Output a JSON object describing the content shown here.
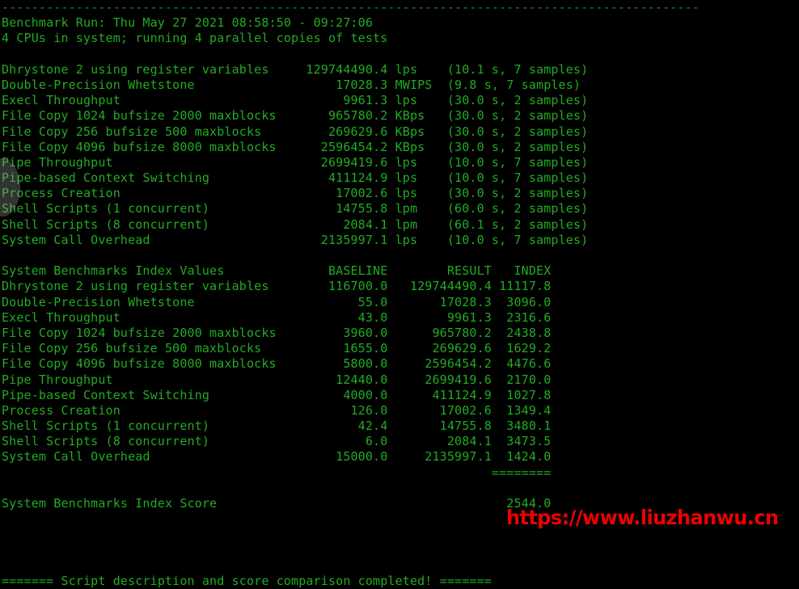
{
  "terminal": {
    "foreground_color": "#23ab23",
    "background_color": "#000000",
    "watermark_color": "#ee0000",
    "top_rule": "----------------------------------------------------------------------------------------------",
    "header": {
      "run_line": "Benchmark Run: Thu May 27 2021 08:58:50 - 09:27:06",
      "cpu_line": "4 CPUs in system; running 4 parallel copies of tests"
    },
    "raw_results": {
      "rows": [
        {
          "label": "Dhrystone 2 using register variables",
          "value": "129744490.4",
          "unit": "lps",
          "detail": "(10.1 s, 7 samples)"
        },
        {
          "label": "Double-Precision Whetstone",
          "value": "17028.3",
          "unit": "MWIPS",
          "detail": "(9.8 s, 7 samples)"
        },
        {
          "label": "Execl Throughput",
          "value": "9961.3",
          "unit": "lps",
          "detail": "(30.0 s, 2 samples)"
        },
        {
          "label": "File Copy 1024 bufsize 2000 maxblocks",
          "value": "965780.2",
          "unit": "KBps",
          "detail": "(30.0 s, 2 samples)"
        },
        {
          "label": "File Copy 256 bufsize 500 maxblocks",
          "value": "269629.6",
          "unit": "KBps",
          "detail": "(30.0 s, 2 samples)"
        },
        {
          "label": "File Copy 4096 bufsize 8000 maxblocks",
          "value": "2596454.2",
          "unit": "KBps",
          "detail": "(30.0 s, 2 samples)"
        },
        {
          "label": "Pipe Throughput",
          "value": "2699419.6",
          "unit": "lps",
          "detail": "(10.0 s, 7 samples)"
        },
        {
          "label": "Pipe-based Context Switching",
          "value": "411124.9",
          "unit": "lps",
          "detail": "(10.0 s, 7 samples)"
        },
        {
          "label": "Process Creation",
          "value": "17002.6",
          "unit": "lps",
          "detail": "(30.0 s, 2 samples)"
        },
        {
          "label": "Shell Scripts (1 concurrent)",
          "value": "14755.8",
          "unit": "lpm",
          "detail": "(60.0 s, 2 samples)"
        },
        {
          "label": "Shell Scripts (8 concurrent)",
          "value": "2084.1",
          "unit": "lpm",
          "detail": "(60.1 s, 2 samples)"
        },
        {
          "label": "System Call Overhead",
          "value": "2135997.1",
          "unit": "lps",
          "detail": "(10.0 s, 7 samples)"
        }
      ]
    },
    "index_values": {
      "title": "System Benchmarks Index Values",
      "columns": [
        "BASELINE",
        "RESULT",
        "INDEX"
      ],
      "rows": [
        {
          "label": "Dhrystone 2 using register variables",
          "baseline": "116700.0",
          "result": "129744490.4",
          "index": "11117.8"
        },
        {
          "label": "Double-Precision Whetstone",
          "baseline": "55.0",
          "result": "17028.3",
          "index": "3096.0"
        },
        {
          "label": "Execl Throughput",
          "baseline": "43.0",
          "result": "9961.3",
          "index": "2316.6"
        },
        {
          "label": "File Copy 1024 bufsize 2000 maxblocks",
          "baseline": "3960.0",
          "result": "965780.2",
          "index": "2438.8"
        },
        {
          "label": "File Copy 256 bufsize 500 maxblocks",
          "baseline": "1655.0",
          "result": "269629.6",
          "index": "1629.2"
        },
        {
          "label": "File Copy 4096 bufsize 8000 maxblocks",
          "baseline": "5800.0",
          "result": "2596454.2",
          "index": "4476.6"
        },
        {
          "label": "Pipe Throughput",
          "baseline": "12440.0",
          "result": "2699419.6",
          "index": "2170.0"
        },
        {
          "label": "Pipe-based Context Switching",
          "baseline": "4000.0",
          "result": "411124.9",
          "index": "1027.8"
        },
        {
          "label": "Process Creation",
          "baseline": "126.0",
          "result": "17002.6",
          "index": "1349.4"
        },
        {
          "label": "Shell Scripts (1 concurrent)",
          "baseline": "42.4",
          "result": "14755.8",
          "index": "3480.1"
        },
        {
          "label": "Shell Scripts (8 concurrent)",
          "baseline": "6.0",
          "result": "2084.1",
          "index": "3473.5"
        },
        {
          "label": "System Call Overhead",
          "baseline": "15000.0",
          "result": "2135997.1",
          "index": "1424.0"
        }
      ],
      "separator": "========",
      "score_label": "System Benchmarks Index Score",
      "score_value": "2544.0"
    },
    "footer": {
      "completion_line": "======= Script description and score comparison completed! ======="
    },
    "watermark": "https://www.liuzhanwu.cn"
  }
}
